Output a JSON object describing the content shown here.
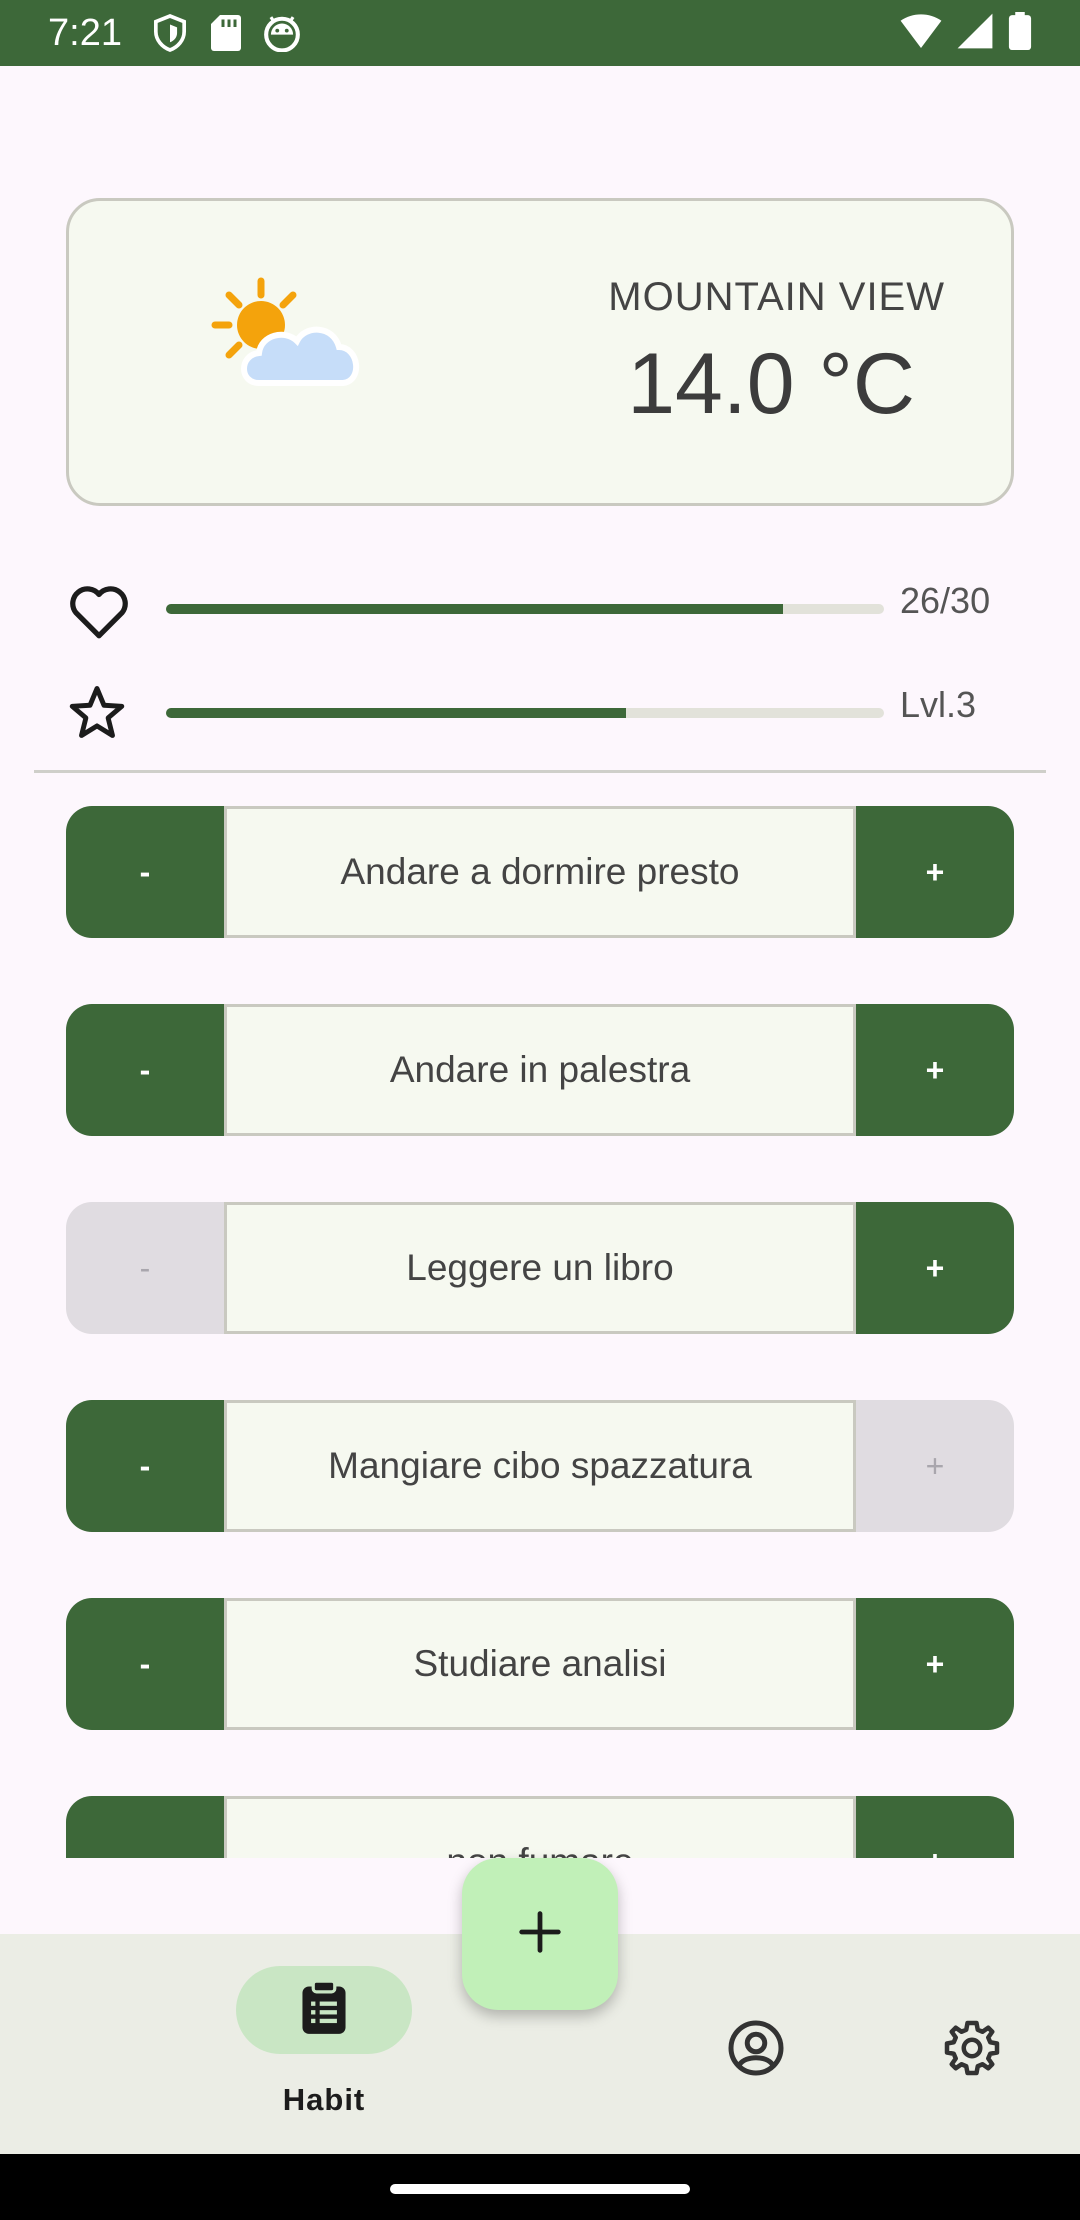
{
  "status_bar": {
    "time": "7:21",
    "background": "#3d6839",
    "left_icons": [
      "shield-icon",
      "sd-card-icon",
      "android-icon"
    ],
    "right_icons": [
      "wifi-icon",
      "signal-icon",
      "battery-icon"
    ]
  },
  "weather": {
    "city": "MOUNTAIN VIEW",
    "temperature": "14.0 °C",
    "icon": "partly-cloudy-icon"
  },
  "stats": {
    "health": {
      "icon": "heart-icon",
      "value_label": "26/30",
      "fraction": 0.86
    },
    "level": {
      "icon": "star-icon",
      "value_label": "Lvl.3",
      "fraction": 0.64
    }
  },
  "habits": [
    {
      "name": "Andare a dormire presto",
      "minus_label": "-",
      "plus_label": "+",
      "minus_enabled": true,
      "plus_enabled": true
    },
    {
      "name": "Andare in palestra",
      "minus_label": "-",
      "plus_label": "+",
      "minus_enabled": true,
      "plus_enabled": true
    },
    {
      "name": "Leggere un libro",
      "minus_label": "-",
      "plus_label": "+",
      "minus_enabled": false,
      "plus_enabled": true
    },
    {
      "name": "Mangiare cibo spazzatura",
      "minus_label": "-",
      "plus_label": "+",
      "minus_enabled": true,
      "plus_enabled": false
    },
    {
      "name": "Studiare analisi",
      "minus_label": "-",
      "plus_label": "+",
      "minus_enabled": true,
      "plus_enabled": true
    },
    {
      "name": "non fumare",
      "minus_label": "-",
      "plus_label": "+",
      "minus_enabled": true,
      "plus_enabled": true
    }
  ],
  "fab": {
    "icon": "plus-icon"
  },
  "bottom_nav": {
    "items": [
      {
        "label": "Habit",
        "icon": "clipboard-icon",
        "selected": true
      },
      {
        "label": "",
        "icon": "profile-icon",
        "selected": false
      },
      {
        "label": "",
        "icon": "gear-icon",
        "selected": false
      }
    ]
  },
  "colors": {
    "primary": "#3d6839",
    "disabled": "#e0dce1",
    "card": "#f6f9f0",
    "fab": "#c1f0b8",
    "nav_indicator": "#c9e6c4",
    "background": "#fdf7fd"
  }
}
